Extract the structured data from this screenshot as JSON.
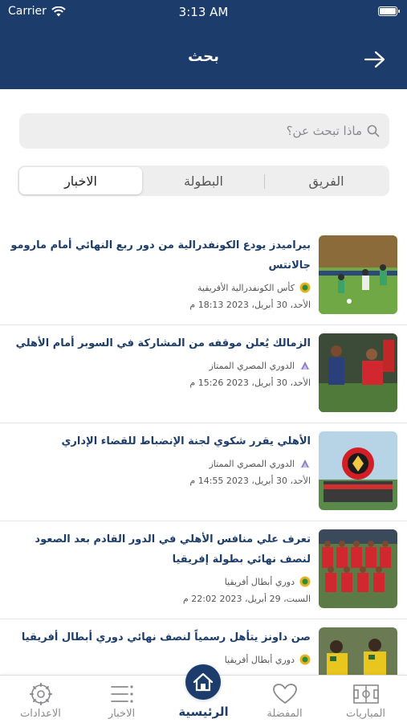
{
  "status_bar": {
    "carrier": "Carrier",
    "time": "3:13 AM"
  },
  "header": {
    "title": "بحث"
  },
  "search": {
    "placeholder": "ماذا تبحث عن؟"
  },
  "segments": [
    {
      "label": "الفريق"
    },
    {
      "label": "البطولة"
    },
    {
      "label": "الاخبار"
    }
  ],
  "news": [
    {
      "title": "بيراميدز يودع الكونفدرالية من دور ربع النهائي أمام مارومو جالانتس",
      "league": "كأس الكونفدرالية الأفريقية",
      "date": "الأحد، 30 أبريل، 2023  18:13 م"
    },
    {
      "title": "الزمالك يُعلن موقفه من المشاركة في السوبر أمام الأهلي",
      "league": "الدوري المصري الممتاز",
      "date": "الأحد، 30 أبريل، 2023  15:26 م"
    },
    {
      "title": "الأهلي يقرر شكوي لجنة الإنضباط للقضاء الإداري",
      "league": "الدوري المصري الممتاز",
      "date": "الأحد، 30 أبريل، 2023  14:55 م"
    },
    {
      "title": "تعرف علي منافس الأهلي في الدور القادم بعد الصعود لنصف نهائي بطولة إفريقيا",
      "league": "دوري أبطال أفريقيا",
      "date": "السبت، 29 أبريل، 2023  22:02 م"
    },
    {
      "title": "صن داونز يتأهل رسمياً لنصف نهائي دوري أبطال أفريقيا",
      "league": "دوري أبطال أفريقيا",
      "date": ""
    }
  ],
  "tabbar": {
    "settings": "الاعدادات",
    "news": "الاخبار",
    "home": "الرئيسية",
    "favorites": "المفضلة",
    "matches": "المباريات"
  }
}
